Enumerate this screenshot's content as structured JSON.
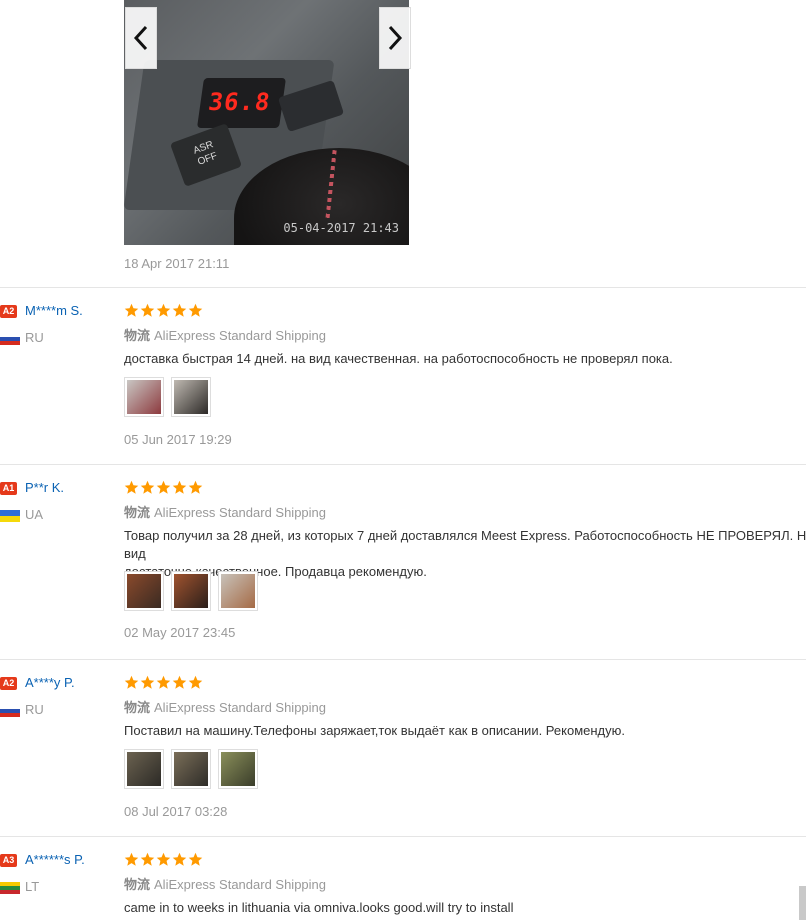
{
  "gallery": {
    "display_reading": "36.8",
    "button_label": "ASR\nOFF",
    "photo_timestamp": "05-04-2017 21:43",
    "date": "18 Apr 2017 21:11",
    "prev_icon": "chevron-left-icon",
    "next_icon": "chevron-right-icon"
  },
  "shipping_label": "物流",
  "reviews": [
    {
      "level": "A2",
      "name": "M****m S.",
      "country": "RU",
      "flag_colors": [
        "#ffffff",
        "#2a4fb0",
        "#d52b1e"
      ],
      "stars": 5,
      "shipping": "AliExpress Standard Shipping",
      "text": "доставка быстрая 14 дней. на вид качественная. на работоспособность не проверял пока.",
      "date": "05 Jun 2017 19:29",
      "thumb_colors": [
        [
          "#c9c7c4",
          "#8d3a3e"
        ],
        [
          "#bfb9b1",
          "#2d2a28"
        ]
      ]
    },
    {
      "level": "A1",
      "name": "P**r K.",
      "country": "UA",
      "flag_colors": [
        "#2e6fd8",
        "#f5d90a"
      ],
      "stars": 5,
      "shipping": "AliExpress Standard Shipping",
      "text": "Товар получил за 28 дней, из которых 7 дней доставлялся Meest Express. Работоспособность НЕ ПРОВЕРЯЛ. На вид\nдостаточно качественное. Продавца рекомендую.",
      "date": "02 May 2017 23:45",
      "thumb_colors": [
        [
          "#8a4a2c",
          "#3a2a22"
        ],
        [
          "#a0532f",
          "#2b1f1a"
        ],
        [
          "#c8c2ba",
          "#a56a45"
        ]
      ]
    },
    {
      "level": "A2",
      "name": "A****y P.",
      "country": "RU",
      "flag_colors": [
        "#ffffff",
        "#2a4fb0",
        "#d52b1e"
      ],
      "stars": 5,
      "shipping": "AliExpress Standard Shipping",
      "text": "Поставил на машину.Телефоны заряжает,ток выдаёт как в описании. Рекомендую.",
      "date": "08 Jul 2017 03:28",
      "thumb_colors": [
        [
          "#6b6250",
          "#2c2a26"
        ],
        [
          "#7a6e58",
          "#2e2c28"
        ],
        [
          "#8a8f5a",
          "#3a3d2a"
        ]
      ]
    },
    {
      "level": "A3",
      "name": "A******s P.",
      "country": "LT",
      "flag_colors": [
        "#f7c900",
        "#2a8a3c",
        "#c8282d"
      ],
      "stars": 5,
      "shipping": "AliExpress Standard Shipping",
      "text": "came in to weeks in lithuania via omniva.looks good.will try to install",
      "date": "",
      "thumb_colors": []
    }
  ],
  "colors": {
    "star": "#ff9a00",
    "badge": "#e5391a",
    "name_link": "#0a62b3"
  }
}
